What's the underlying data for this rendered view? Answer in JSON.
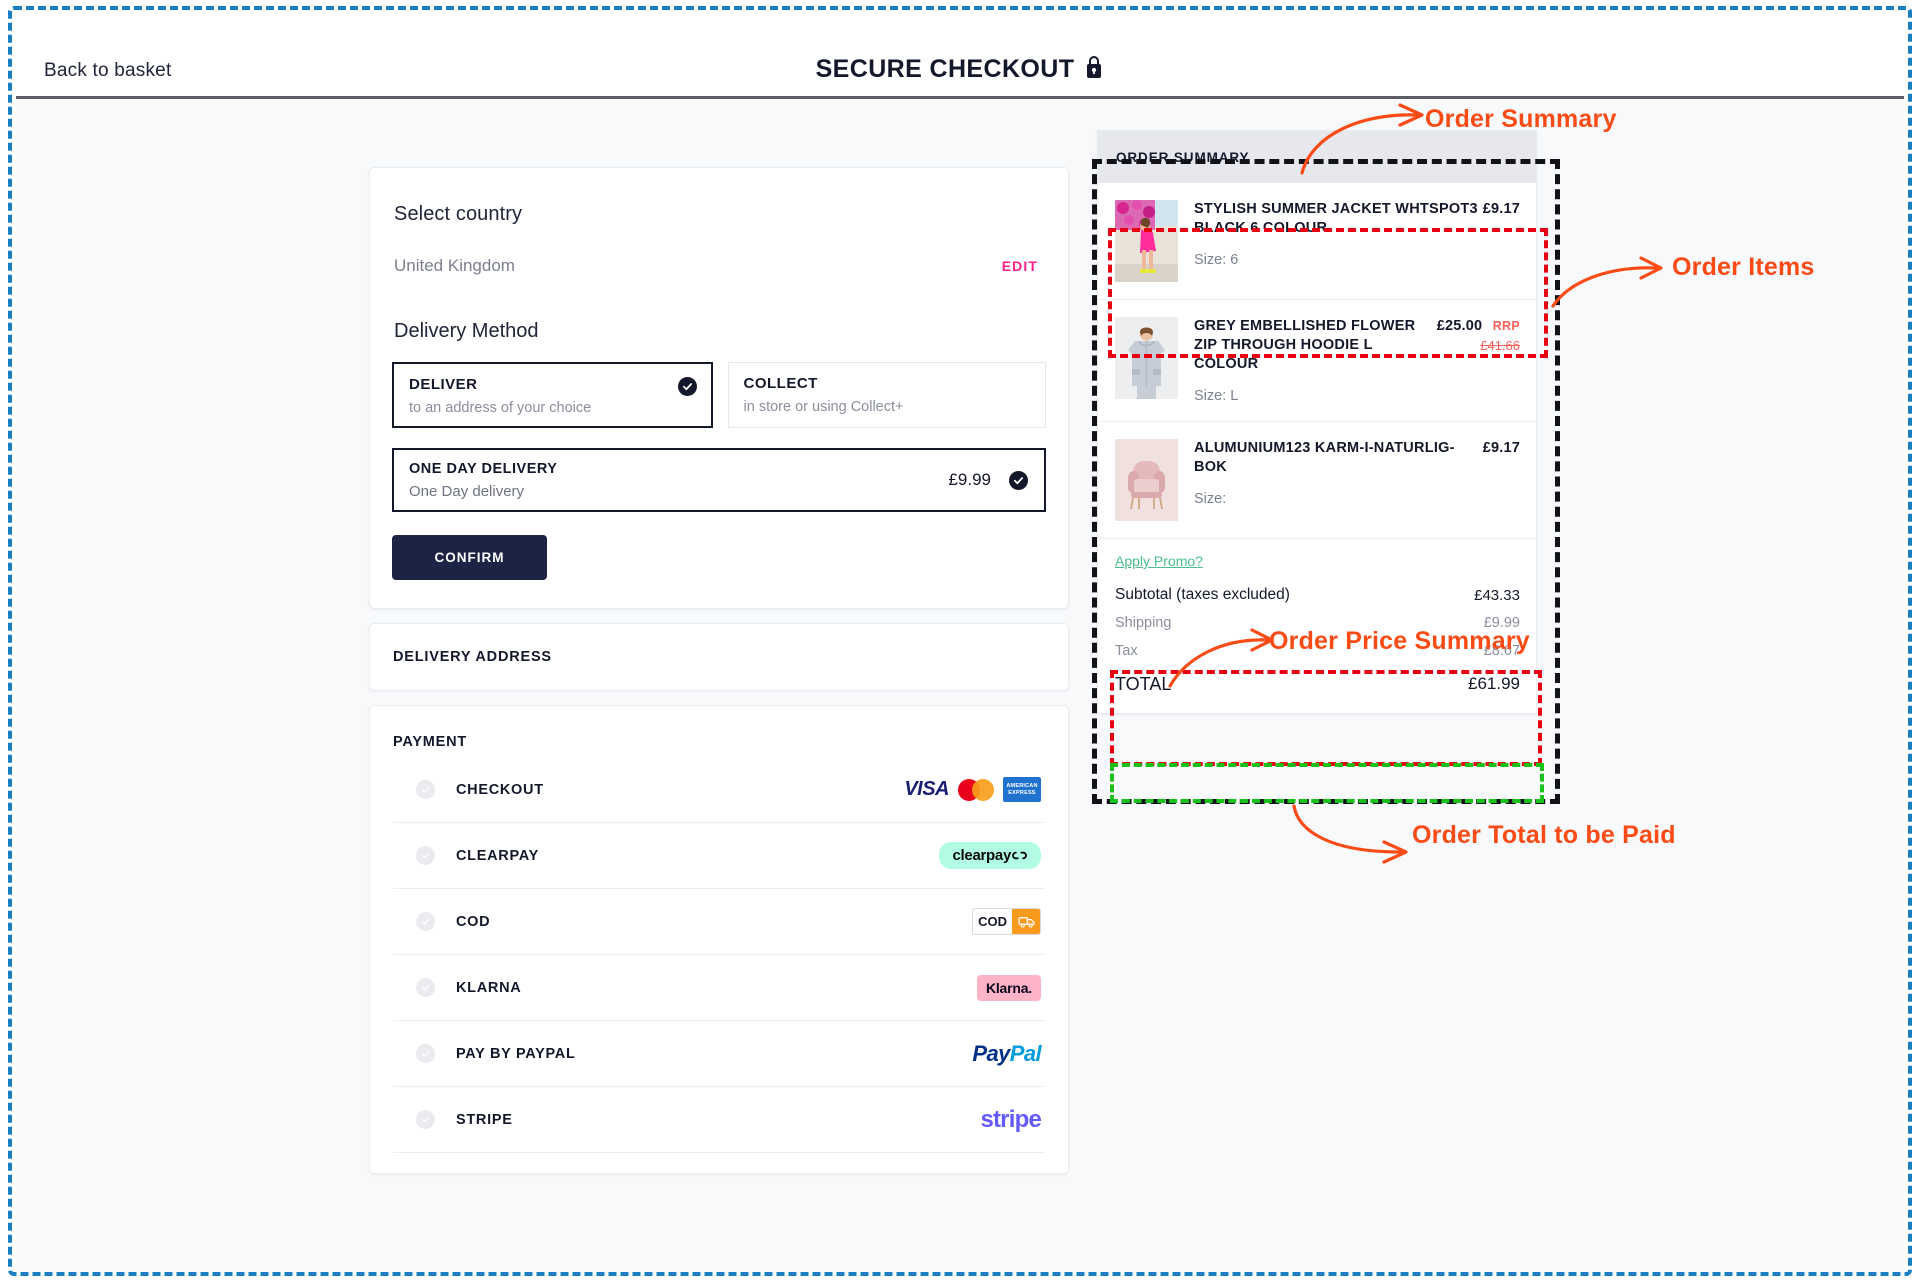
{
  "header": {
    "back_label": "Back to basket",
    "title": "SECURE CHECKOUT",
    "lock_icon": "lock-icon"
  },
  "delivery": {
    "country_title": "Select country",
    "country_value": "United Kingdom",
    "edit_label": "EDIT",
    "method_title": "Delivery Method",
    "methods": [
      {
        "name": "DELIVER",
        "sub": "to an address of your choice",
        "selected": true
      },
      {
        "name": "COLLECT",
        "sub": "in store or using Collect+",
        "selected": false
      }
    ],
    "shipping_option": {
      "name": "ONE DAY DELIVERY",
      "desc": "One Day delivery",
      "price": "£9.99",
      "selected": true
    },
    "confirm_label": "CONFIRM"
  },
  "address": {
    "label": "DELIVERY ADDRESS"
  },
  "payment": {
    "label": "PAYMENT",
    "methods": [
      {
        "name": "CHECKOUT",
        "logos": [
          "visa-logo",
          "mastercard-logo",
          "amex-logo"
        ]
      },
      {
        "name": "CLEARPAY",
        "logos": [
          "clearpay-logo"
        ]
      },
      {
        "name": "COD",
        "logos": [
          "cod-logo"
        ]
      },
      {
        "name": "KLARNA",
        "logos": [
          "klarna-logo"
        ]
      },
      {
        "name": "PAY BY PAYPAL",
        "logos": [
          "paypal-logo"
        ]
      },
      {
        "name": "STRIPE",
        "logos": [
          "stripe-logo"
        ]
      }
    ],
    "brand_text": {
      "visa": "VISA",
      "amex_line1": "AMERICAN",
      "amex_line2": "EXPRESS",
      "clearpay": "clearpay",
      "cod": "COD",
      "klarna": "Klarna.",
      "paypal_a": "Pay",
      "paypal_b": "Pal",
      "stripe": "stripe"
    }
  },
  "order_summary": {
    "heading": "ORDER SUMMARY",
    "items": [
      {
        "title": "STYLISH SUMMER JACKET WHTSPOT3 BLACK 6 COLOUR",
        "price": "£9.17",
        "rrp_label": "",
        "rrp_value": "",
        "size": "Size: 6",
        "thumb": "product-image-pink-dress"
      },
      {
        "title": "GREY EMBELLISHED FLOWER ZIP THROUGH HOODIE L COLOUR",
        "price": "£25.00",
        "rrp_label": "RRP",
        "rrp_value": "£41.66",
        "size": "Size: L",
        "thumb": "product-image-grey-hoodie"
      },
      {
        "title": "ALUMUNIUM123 KARM-I-NATURLIG-BOK",
        "price": "£9.17",
        "rrp_label": "",
        "rrp_value": "",
        "size": "Size:",
        "thumb": "product-image-pink-armchair"
      }
    ],
    "promo_label": "Apply Promo?",
    "totals": [
      {
        "key": "Subtotal (taxes excluded)",
        "value": "£43.33",
        "muted": false
      },
      {
        "key": "Shipping",
        "value": "£9.99",
        "muted": true
      },
      {
        "key": "Tax",
        "value": "£8.67",
        "muted": true
      }
    ],
    "grand_total": {
      "key": "TOTAL",
      "value": "£61.99"
    }
  },
  "annotations": {
    "order_summary": "Order Summary",
    "order_items": "Order Items",
    "order_price_summary": "Order Price Summary",
    "order_total": "Order Total to be Paid",
    "colors": {
      "callout": "#fa4b16",
      "summary_box": "#111318",
      "items_box": "#e60012",
      "total_box": "#19c11a",
      "frame": "#1a7fc1"
    }
  }
}
